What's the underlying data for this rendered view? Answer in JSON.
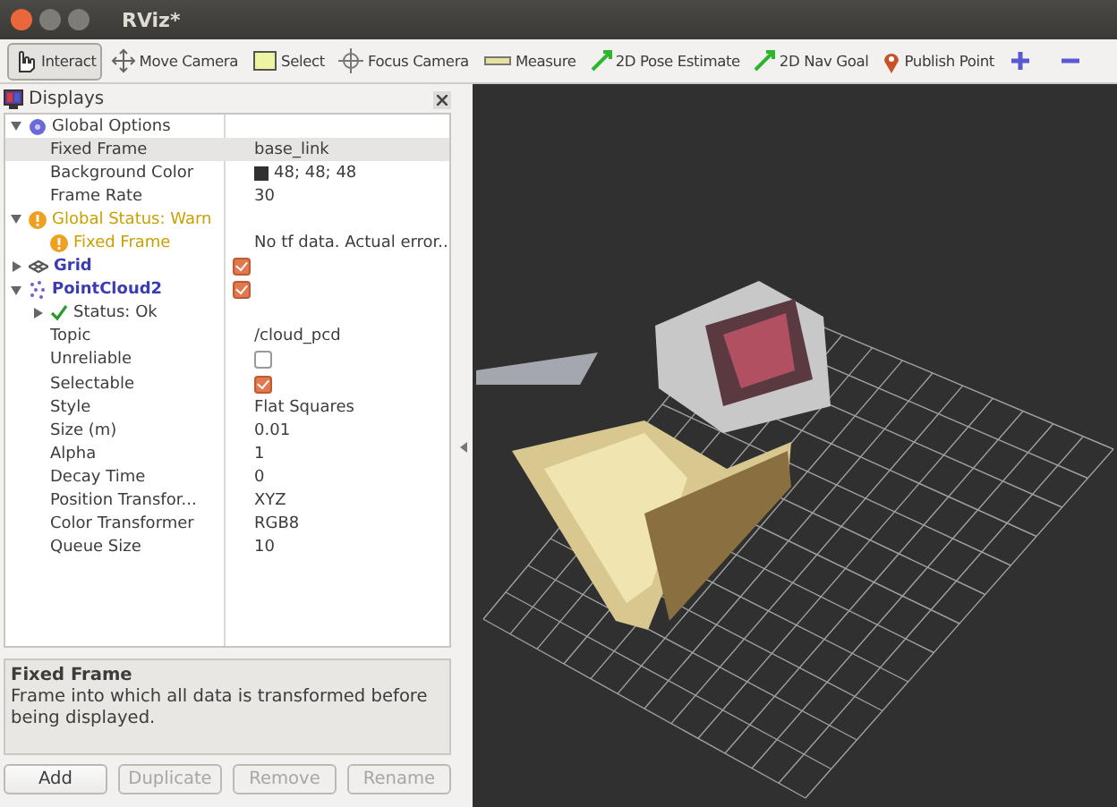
{
  "window": {
    "title": "RViz*"
  },
  "toolbar": {
    "tools": [
      {
        "kind": "interact",
        "label": "Interact",
        "selected": true
      },
      {
        "kind": "move",
        "label": "Move Camera",
        "selected": false
      },
      {
        "kind": "select",
        "label": "Select",
        "selected": false
      },
      {
        "kind": "focus",
        "label": "Focus Camera",
        "selected": false
      },
      {
        "kind": "measure",
        "label": "Measure",
        "selected": false
      },
      {
        "kind": "pose",
        "label": "2D Pose Estimate",
        "selected": false
      },
      {
        "kind": "goal",
        "label": "2D Nav Goal",
        "selected": false
      },
      {
        "kind": "point",
        "label": "Publish Point",
        "selected": false
      }
    ]
  },
  "displays": {
    "title": "Displays",
    "rows": [
      {
        "kind": "options",
        "label": "Global Options",
        "selected": false,
        "expanded": true,
        "children": [
          {
            "kind": "property",
            "label": "Fixed Frame",
            "value": "base_link",
            "selected": true
          },
          {
            "kind": "property",
            "label": "Background Color",
            "value": "48; 48; 48",
            "color": "#303030",
            "selected": false
          },
          {
            "kind": "property",
            "label": "Frame Rate",
            "value": "30",
            "selected": false
          }
        ]
      },
      {
        "kind": "warn",
        "label": "Global Status: Warn",
        "selected": false,
        "expanded": true,
        "children": [
          {
            "kind": "warn",
            "label": "Fixed Frame",
            "value": "No tf data.  Actual error...",
            "selected": false
          }
        ]
      },
      {
        "kind": "grid",
        "label": "Grid",
        "checked": true,
        "selected": false,
        "expanded": false
      },
      {
        "kind": "pointcloud",
        "label": "PointCloud2",
        "checked": true,
        "selected": false,
        "expanded": true,
        "children": [
          {
            "kind": "ok",
            "label": "Status: Ok",
            "selected": false,
            "expanded": false
          },
          {
            "kind": "property",
            "label": "Topic",
            "value": "/cloud_pcd",
            "selected": false
          },
          {
            "kind": "property",
            "label": "Unreliable",
            "checked": false,
            "selected": false
          },
          {
            "kind": "property",
            "label": "Selectable",
            "checked": true,
            "selected": false
          },
          {
            "kind": "property",
            "label": "Style",
            "value": "Flat Squares",
            "selected": false
          },
          {
            "kind": "property",
            "label": "Size (m)",
            "value": "0.01",
            "selected": false
          },
          {
            "kind": "property",
            "label": "Alpha",
            "value": "1",
            "selected": false
          },
          {
            "kind": "property",
            "label": "Decay Time",
            "value": "0",
            "selected": false
          },
          {
            "kind": "property",
            "label": "Position Transfor...",
            "value": "XYZ",
            "selected": false
          },
          {
            "kind": "property",
            "label": "Color Transformer",
            "value": "RGB8",
            "selected": false
          },
          {
            "kind": "property",
            "label": "Queue Size",
            "value": "10",
            "selected": false
          }
        ]
      }
    ],
    "description": {
      "title": "Fixed Frame",
      "text": "Frame into which all data is transformed before being displayed."
    },
    "buttons": [
      {
        "label": "Add",
        "disabled": false
      },
      {
        "label": "Duplicate",
        "disabled": true
      },
      {
        "label": "Remove",
        "disabled": true
      },
      {
        "label": "Rename",
        "disabled": true
      }
    ]
  }
}
